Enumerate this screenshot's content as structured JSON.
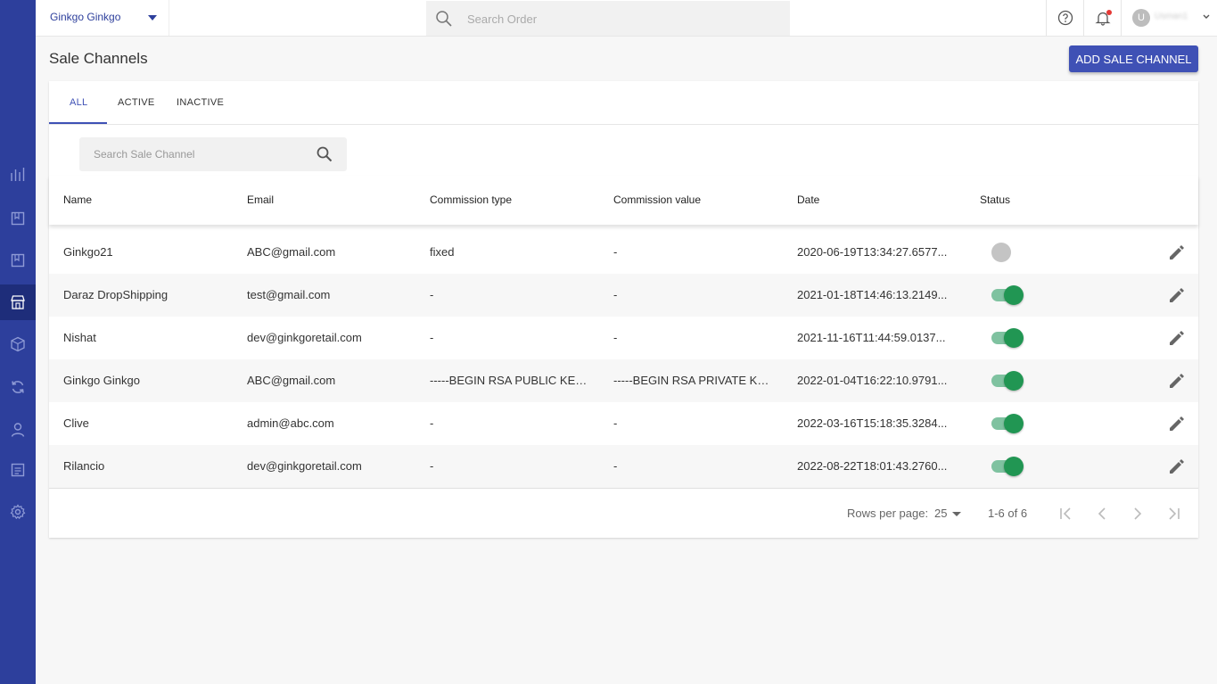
{
  "topbar": {
    "store_selector": "Ginkgo Ginkgo",
    "order_search_placeholder": "Search Order",
    "user_initial": "U",
    "user_name": "Usman1"
  },
  "sidebar": {
    "items": [
      {
        "icon": "bar-chart-icon"
      },
      {
        "icon": "book-icon"
      },
      {
        "icon": "bookmark-icon"
      },
      {
        "icon": "store-icon",
        "active": true
      },
      {
        "icon": "box-icon"
      },
      {
        "icon": "sync-icon"
      },
      {
        "icon": "user-icon"
      },
      {
        "icon": "report-icon"
      },
      {
        "icon": "gear-icon"
      }
    ]
  },
  "page": {
    "title": "Sale Channels",
    "add_button": "ADD SALE CHANNEL"
  },
  "tabs": [
    {
      "label": "ALL",
      "active": true
    },
    {
      "label": "ACTIVE"
    },
    {
      "label": "INACTIVE"
    }
  ],
  "filter": {
    "search_placeholder": "Search Sale Channel"
  },
  "table": {
    "headers": [
      "Name",
      "Email",
      "Commission type",
      "Commission value",
      "Date",
      "Status"
    ],
    "rows": [
      {
        "name": "Ginkgo21",
        "email": "ABC@gmail.com",
        "commission_type": "fixed",
        "commission_value": "-",
        "date": "2020-06-19T13:34:27.6577...",
        "status": false
      },
      {
        "name": "Daraz DropShipping",
        "email": "test@gmail.com",
        "commission_type": "-",
        "commission_value": "-",
        "date": "2021-01-18T14:46:13.2149...",
        "status": true
      },
      {
        "name": "Nishat",
        "email": "dev@ginkgoretail.com",
        "commission_type": "-",
        "commission_value": "-",
        "date": "2021-11-16T11:44:59.0137...",
        "status": true
      },
      {
        "name": "Ginkgo Ginkgo",
        "email": "ABC@gmail.com",
        "commission_type": "-----BEGIN RSA PUBLIC KEY...",
        "commission_value": "-----BEGIN RSA PRIVATE KE...",
        "date": "2022-01-04T16:22:10.9791...",
        "status": true
      },
      {
        "name": "Clive",
        "email": "admin@abc.com",
        "commission_type": "-",
        "commission_value": "-",
        "date": "2022-03-16T15:18:35.3284...",
        "status": true
      },
      {
        "name": "Rilancio",
        "email": "dev@ginkgoretail.com",
        "commission_type": "-",
        "commission_value": "-",
        "date": "2022-08-22T18:01:43.2760...",
        "status": true
      }
    ]
  },
  "pagination": {
    "rows_per_page_label": "Rows per page:",
    "rows_per_page": "25",
    "range": "1-6 of 6"
  },
  "colors": {
    "sidebar": "#2d3f9c",
    "primary": "#3f51b5",
    "toggle_on": "#219653",
    "toggle_off": "#c4c4c4",
    "notification": "#e53935"
  }
}
